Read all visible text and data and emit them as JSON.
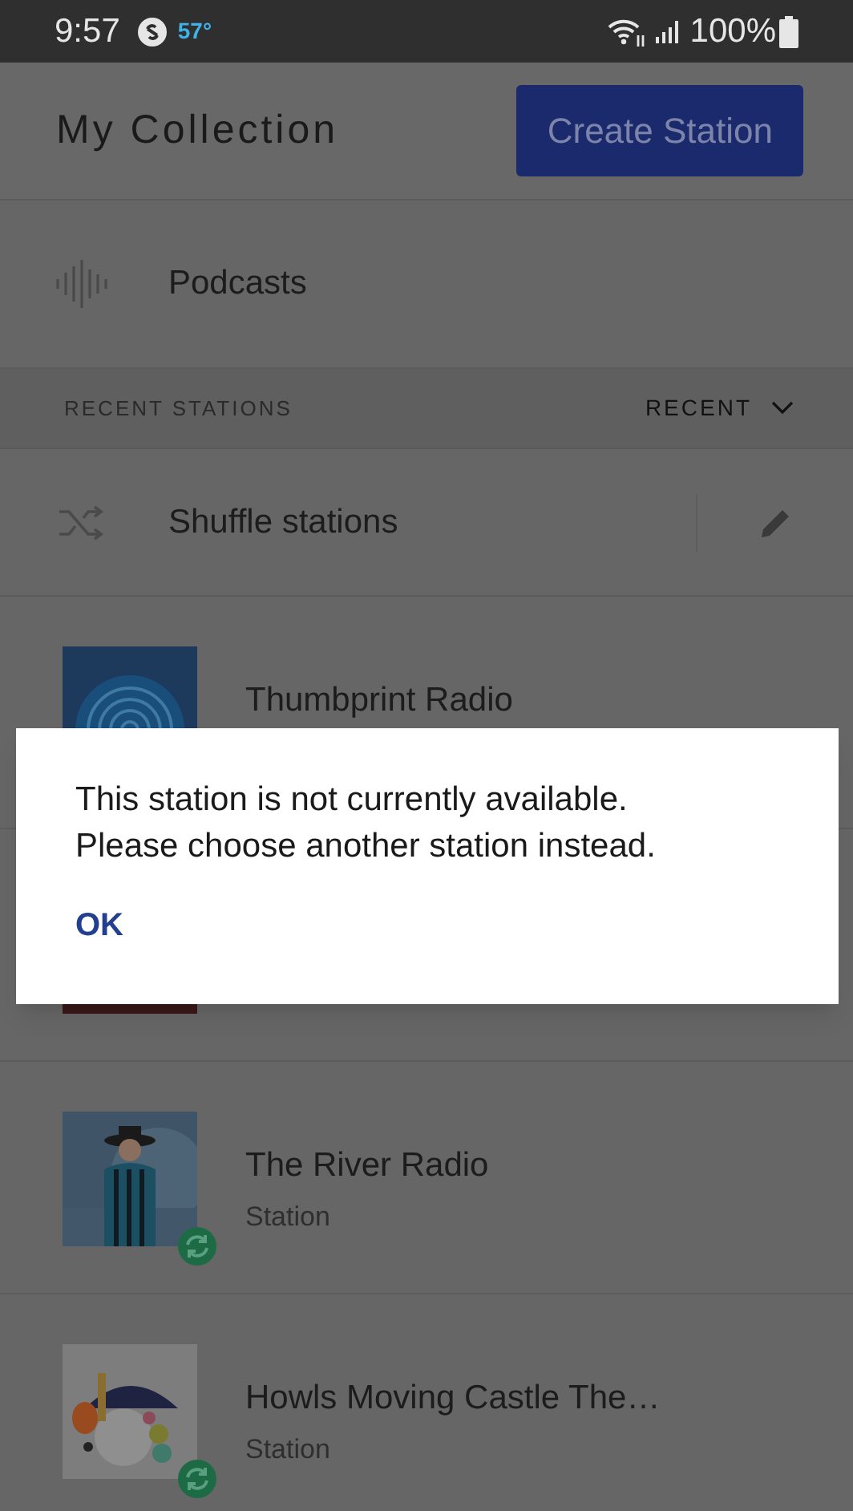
{
  "status_bar": {
    "time": "9:57",
    "temperature": "57°",
    "battery": "100%"
  },
  "header": {
    "title": "My Collection",
    "button": "Create Station"
  },
  "podcasts": {
    "label": "Podcasts"
  },
  "section": {
    "title": "RECENT STATIONS",
    "sort": "RECENT"
  },
  "shuffle": {
    "label": "Shuffle stations"
  },
  "stations": [
    {
      "kind": "picture",
      "title": "Thumbprint Radio"
    },
    {
      "kind": "picture"
    },
    {
      "kind": "picture",
      "title": "The River Radio",
      "subtitle": "Station",
      "synced": true
    },
    {
      "kind": "picture",
      "title": "Howls Moving Castle The…",
      "subtitle": "Station",
      "synced": true
    }
  ],
  "dialog": {
    "message": "This station is not currently available. Please choose another station instead.",
    "button": "OK"
  }
}
